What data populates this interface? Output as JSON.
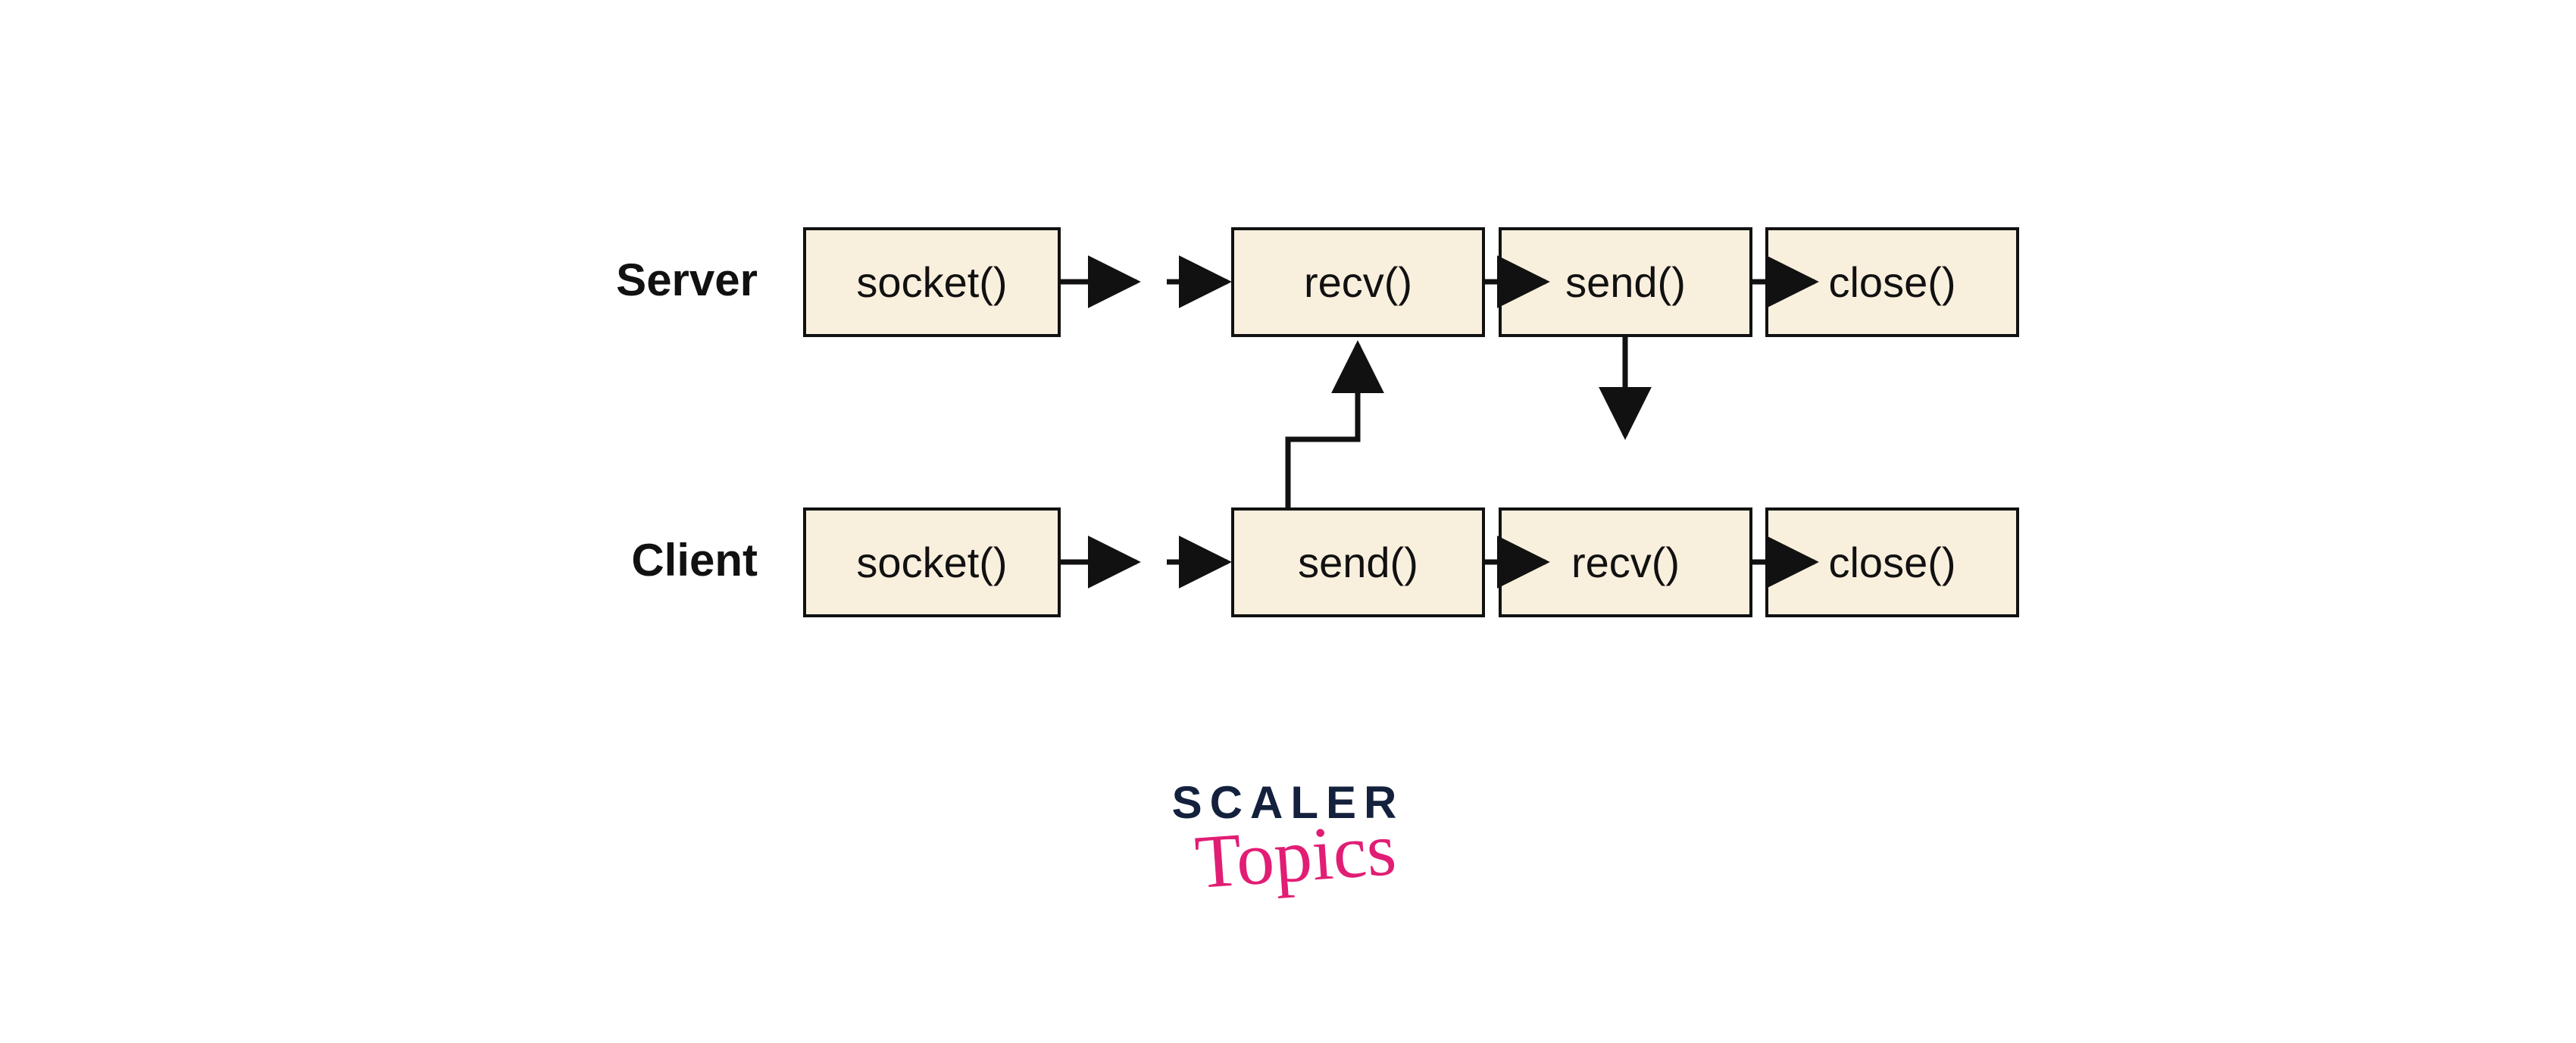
{
  "rows": {
    "server": {
      "label": "Server"
    },
    "client": {
      "label": "Client"
    }
  },
  "nodes": {
    "server_socket": "socket()",
    "server_recv": "recv()",
    "server_send": "send()",
    "server_close": "close()",
    "client_socket": "socket()",
    "client_send": "send()",
    "client_recv": "recv()",
    "client_close": "close()"
  },
  "logo": {
    "line1": "SCALER",
    "line2": "Topics"
  },
  "colors": {
    "node_fill": "#f9efdd",
    "stroke": "#111111",
    "logo_dark": "#14213d",
    "logo_pink": "#e11d74"
  }
}
